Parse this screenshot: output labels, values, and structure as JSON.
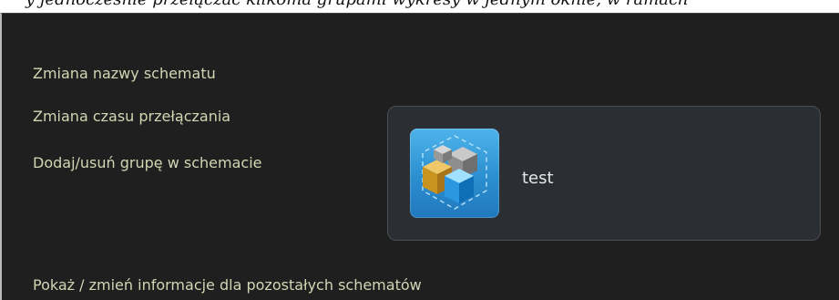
{
  "top_clipped_text": "y jednoczesnie przelączać kilkoma grupami wykresy w jednym oknie, w ramach",
  "menu": {
    "rename_scheme": "Zmiana nazwy schematu",
    "change_switch_time": "Zmiana czasu przełączania",
    "add_remove_group": "Dodaj/usuń grupę w schemacie",
    "show_other_schemes": "Pokaż / zmień informacje dla pozostałych schematów"
  },
  "scheme": {
    "name": "test",
    "icon": "cube-stack-icon"
  },
  "colors": {
    "panel_bg": "#1f1f1f",
    "link_text": "#cfd7b3",
    "card_bg": "#2b2f33",
    "icon_blue": "#2b8fd0"
  }
}
